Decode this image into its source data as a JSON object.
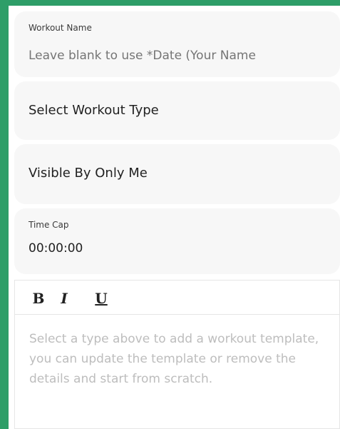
{
  "workout_name": {
    "label": "Workout Name",
    "placeholder": "Leave blank to use *Date (Your Name"
  },
  "workout_type": {
    "value": "Select Workout Type"
  },
  "visibility": {
    "value": "Visible By Only Me"
  },
  "time_cap": {
    "label": "Time Cap",
    "value": "00:00:00"
  },
  "editor": {
    "toolbar": {
      "bold": "B",
      "italic": "I",
      "underline": "U"
    },
    "placeholder": "Select a type above to add a workout template, you can update the template or remove the details and start from scratch."
  },
  "colors": {
    "background": "#2e9e68",
    "field_bg": "#f7f7f7",
    "placeholder_text": "#bdbdbd"
  }
}
